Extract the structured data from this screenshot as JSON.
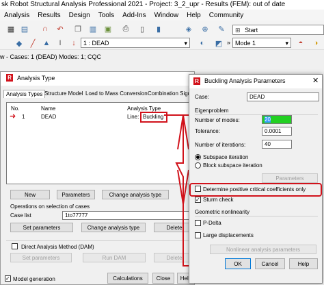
{
  "app": {
    "title": "sk Robot Structural Analysis Professional 2021 - Project: 3_2_upr - Results (FEM): out of date"
  },
  "menu": [
    "Analysis",
    "Results",
    "Design",
    "Tools",
    "Add-Ins",
    "Window",
    "Help",
    "Community"
  ],
  "toolbar": {
    "case_value": "1 : DEAD",
    "start_value": "Start",
    "mode_value": "Mode 1",
    "mode_prefix": "»"
  },
  "status_line": "w - Cases: 1 (DEAD)  Modes: 1; CQC",
  "analysis_type": {
    "title": "Analysis Type",
    "tabs": [
      "Analysis Types",
      "Structure Model",
      "Load to Mass Conversion",
      "Combination Sign"
    ],
    "columns": [
      "No.",
      "Name",
      "Analysis Type"
    ],
    "row": {
      "no": "1",
      "name": "DEAD",
      "type_prefix": "Line:",
      "type_value": "Buckling"
    },
    "buttons": {
      "new": "New",
      "parameters": "Parameters",
      "change_type": "Change analysis type"
    },
    "operations_label": "Operations on selection of cases",
    "case_list_label": "Case list",
    "case_list_value": "1to77777",
    "set_parameters": "Set parameters",
    "change_type2": "Change analysis type",
    "delete": "Delete",
    "dam_label": "Direct Analysis Method (DAM)",
    "set_parameters_dam": "Set parameters",
    "run_dam": "Run DAM",
    "delete_dam": "Delete",
    "model_generation": "Model generation",
    "calculations": "Calculations",
    "close": "Close",
    "help": "Help"
  },
  "buckling": {
    "title": "Buckling Analysis Parameters",
    "case_label": "Case:",
    "case_value": "DEAD",
    "eigenproblem_label": "Eigenproblem",
    "num_modes_label": "Number of modes:",
    "num_modes_value": "20",
    "tolerance_label": "Tolerance:",
    "tolerance_value": "0.0001",
    "iterations_label": "Number of iterations:",
    "iterations_value": "40",
    "subspace_label": "Subspace iteration",
    "block_label": "Block subspace iteration",
    "parameters_button": "Parameters",
    "positive_label": "Determine positive critical coefficients only",
    "sturm_label": "Sturm check",
    "geom_label": "Geometric nonlinearity",
    "pdelta_label": "P-Delta",
    "large_label": "Large displacements",
    "nonlinear_button": "Nonlinear analysis parameters",
    "ok": "OK",
    "cancel": "Cancel",
    "help": "Help"
  },
  "colors": {
    "highlight_red": "#d1121b",
    "field_green": "#22d022",
    "selection_blue": "#3399ff"
  }
}
